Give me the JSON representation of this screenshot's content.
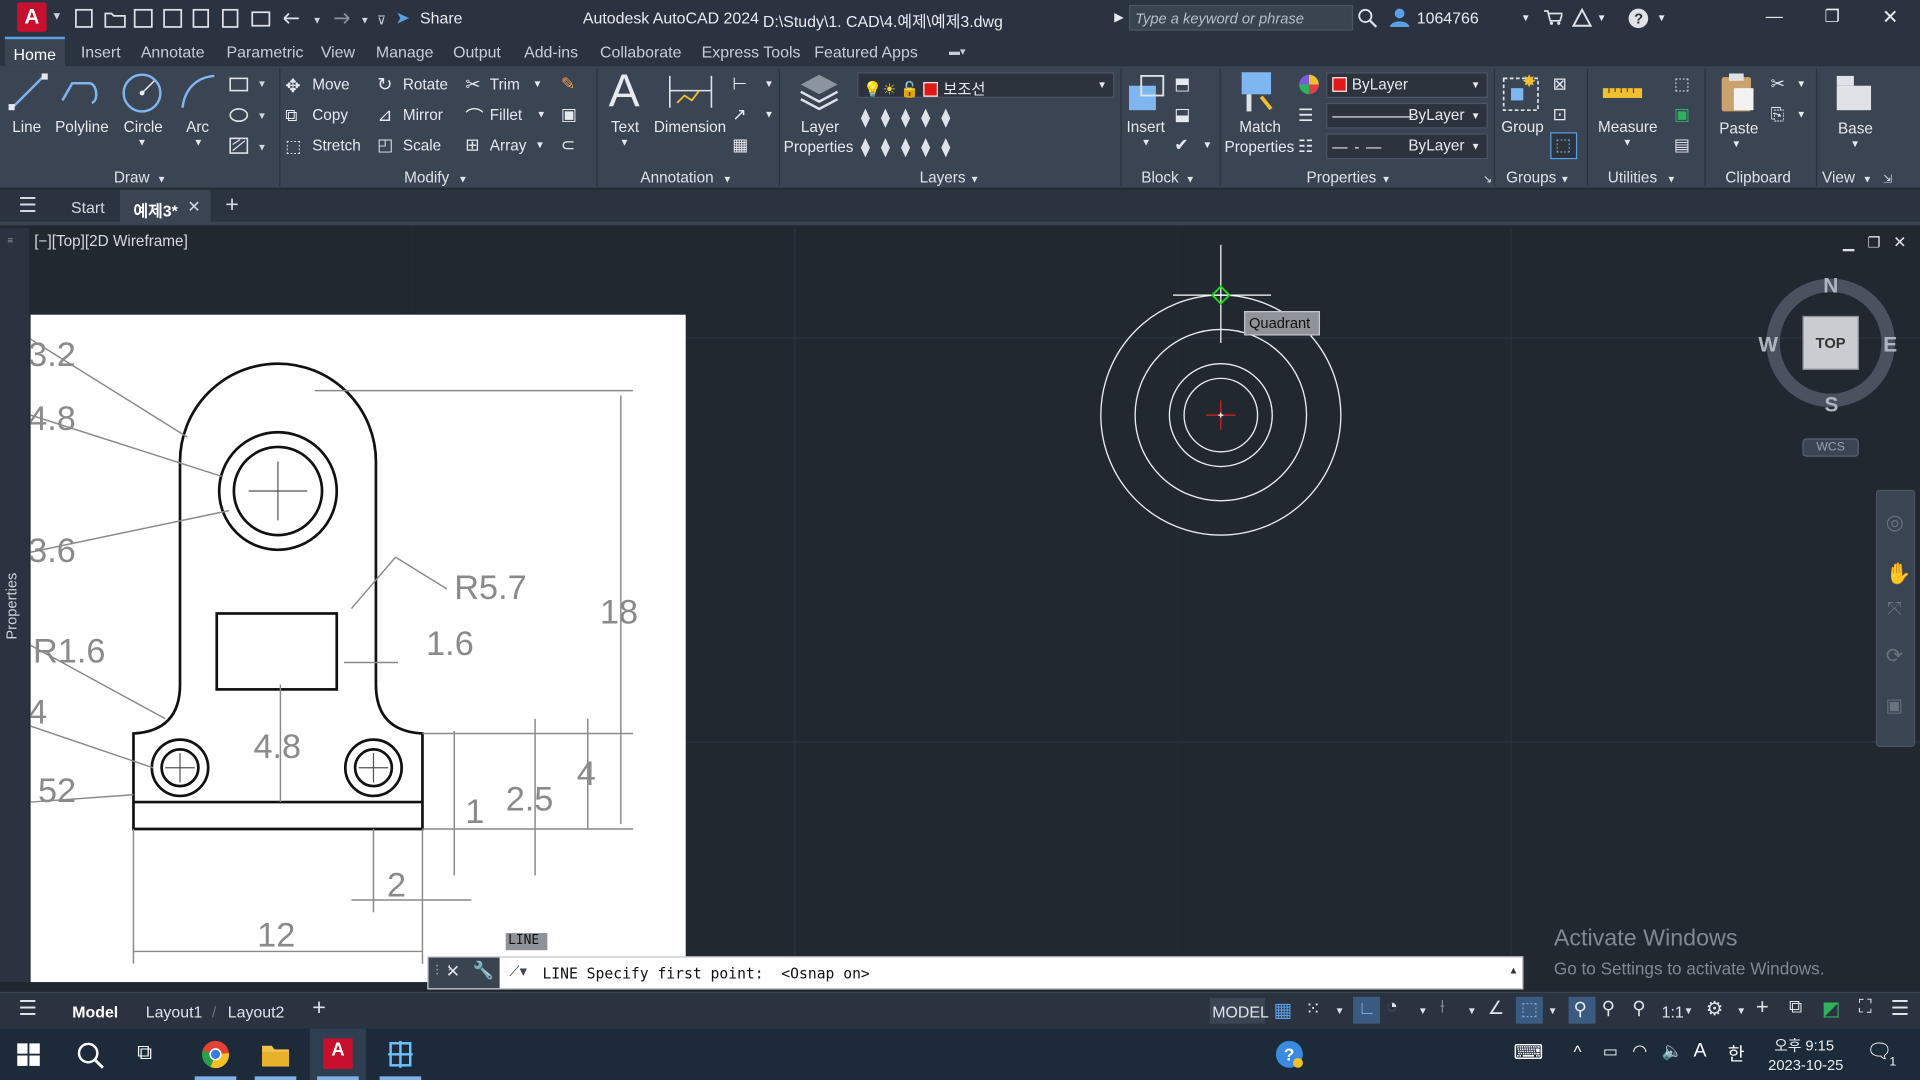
{
  "app": {
    "title": "Autodesk AutoCAD 2024",
    "file_path": "D:\\Study\\1. CAD\\4.예제\\예제3.dwg",
    "share_label": "Share",
    "search_placeholder": "Type a keyword or phrase",
    "user": "1064766",
    "logo_letter": "A"
  },
  "ribbon_tabs": [
    "Home",
    "Insert",
    "Annotate",
    "Parametric",
    "View",
    "Manage",
    "Output",
    "Add-ins",
    "Collaborate",
    "Express Tools",
    "Featured Apps"
  ],
  "ribbon": {
    "draw": {
      "title": "Draw",
      "line": "Line",
      "polyline": "Polyline",
      "circle": "Circle",
      "arc": "Arc"
    },
    "modify": {
      "title": "Modify",
      "move": "Move",
      "rotate": "Rotate",
      "trim": "Trim",
      "copy": "Copy",
      "mirror": "Mirror",
      "fillet": "Fillet",
      "stretch": "Stretch",
      "scale": "Scale",
      "array": "Array"
    },
    "annotation": {
      "title": "Annotation",
      "text": "Text",
      "dimension": "Dimension"
    },
    "layers": {
      "title": "Layers",
      "layer_properties_1": "Layer",
      "layer_properties_2": "Properties",
      "current_layer": "보조선"
    },
    "block": {
      "title": "Block",
      "insert": "Insert"
    },
    "properties": {
      "title": "Properties",
      "match_1": "Match",
      "match_2": "Properties",
      "color": "ByLayer",
      "lineweight": "ByLayer",
      "linetype": "ByLayer"
    },
    "groups": {
      "title": "Groups",
      "group": "Group"
    },
    "utilities": {
      "title": "Utilities",
      "measure": "Measure"
    },
    "clipboard": {
      "title": "Clipboard",
      "paste": "Paste"
    },
    "view": {
      "title": "View",
      "base": "Base"
    }
  },
  "file_tabs": {
    "start": "Start",
    "active": "예제3*"
  },
  "viewport": {
    "label": "[−][Top][2D Wireframe]",
    "side_palette": "Properties",
    "osnap_tooltip": "Quadrant",
    "command_tag": "LINE",
    "command_prompt": "LINE Specify first point:  <Osnap on>",
    "compass": {
      "n": "N",
      "s": "S",
      "e": "E",
      "w": "W",
      "top": "TOP",
      "ucs": "WCS"
    }
  },
  "reference_drawing": {
    "dims": [
      "3.2",
      "4.8",
      "3.6",
      "R1.6",
      "4",
      "52",
      "R5.7",
      "1.6",
      "18",
      "4.8",
      "2.5",
      "4",
      "1",
      "2",
      "12"
    ]
  },
  "activate_windows": {
    "line1": "Activate Windows",
    "line2": "Go to Settings to activate Windows."
  },
  "layout_tabs": [
    "Model",
    "Layout1",
    "Layout2"
  ],
  "status": {
    "model": "MODEL",
    "scale": "1:1"
  },
  "taskbar": {
    "ime_lang": "A",
    "ime_mode": "한",
    "time": "오후 9:15",
    "date": "2023-10-25",
    "notifications": "1"
  },
  "colors": {
    "accent": "#5aa0e6",
    "layer_red": "#e01818",
    "osnap_green": "#1fd61f",
    "crosshair_red": "#e02020"
  }
}
